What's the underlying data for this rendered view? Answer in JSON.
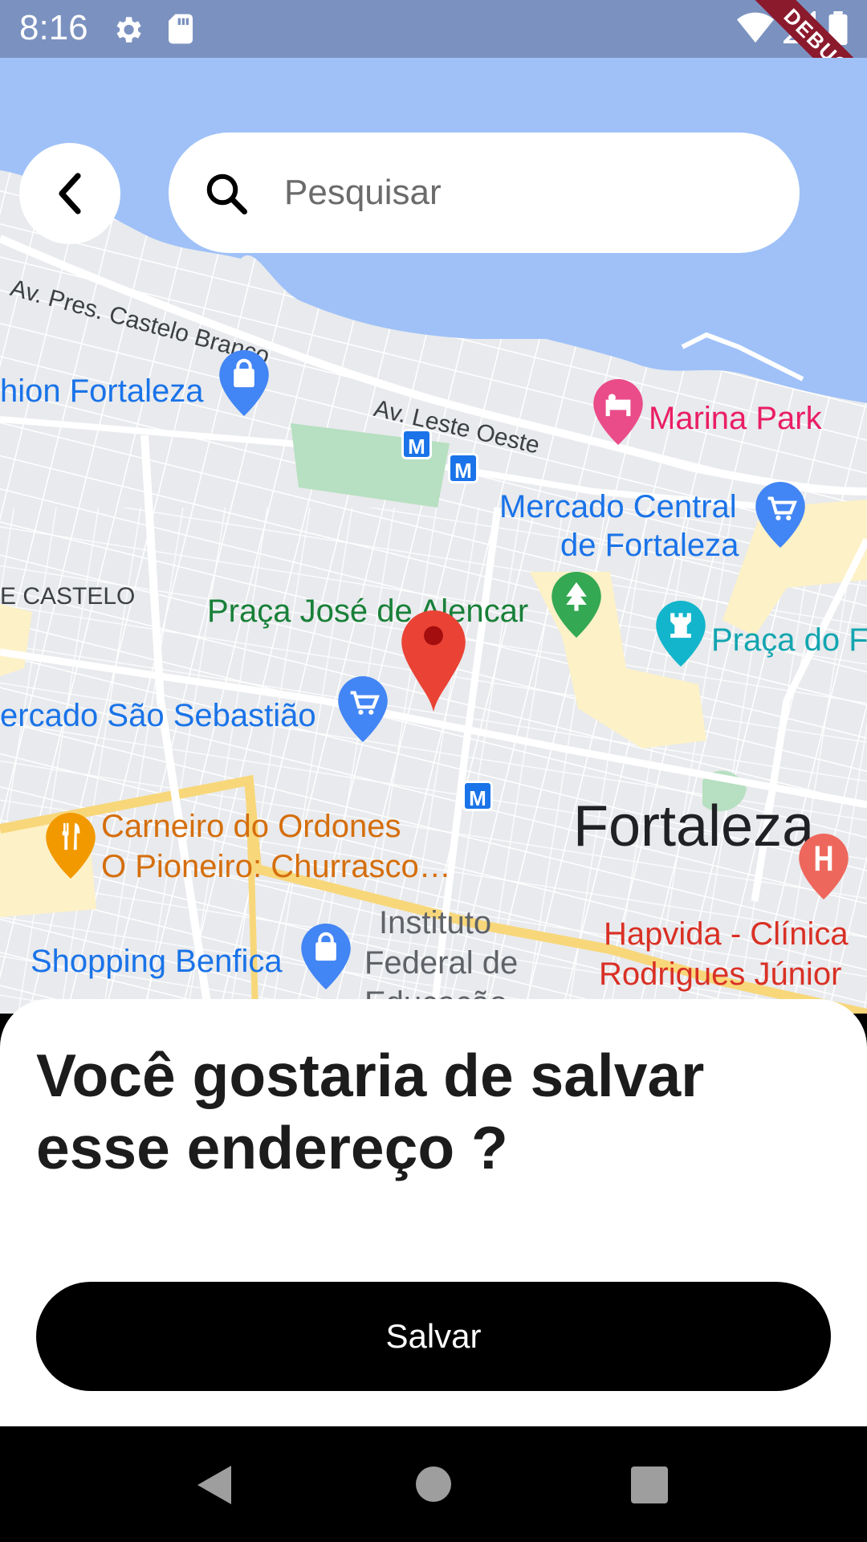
{
  "status_bar": {
    "time": "8:16",
    "debug_label": "DEBUG",
    "icons": [
      "settings-icon",
      "sd-card-icon",
      "wifi-icon",
      "signal-icon",
      "battery-icon"
    ]
  },
  "search": {
    "placeholder": "Pesquisar",
    "value": ""
  },
  "map": {
    "city_label": "Fortaleza",
    "places": [
      {
        "name": "hion Fortaleza",
        "icon": "shopping-bag-icon"
      },
      {
        "name": "Marina Park",
        "icon": "hotel-icon"
      },
      {
        "name": "Mercado Central de Fortaleza",
        "line1": "Mercado Central",
        "line2": "de Fortaleza",
        "icon": "cart-icon"
      },
      {
        "name": "Praça José de Alencar",
        "icon": "tree-icon"
      },
      {
        "name": "Praça do F",
        "icon": "chess-icon"
      },
      {
        "name": "ercado São Sebastião",
        "icon": "cart-icon"
      },
      {
        "name": "Carneiro do Ordones O Pioneiro: Churrasco…",
        "line1": "Carneiro do Ordones",
        "line2": "O Pioneiro: Churrasco…",
        "icon": "restaurant-icon"
      },
      {
        "name": "Shopping Benfica",
        "icon": "shopping-bag-icon"
      },
      {
        "name": "Instituto Federal de Educação",
        "line1": "Instituto",
        "line2": "Federal de",
        "line3": "Educação",
        "icon": ""
      },
      {
        "name": "Hapvida - Clínica Rodrigues Júnior",
        "line1": "Hapvida - Clínica",
        "line2": "Rodrigues Júnior",
        "icon": "hospital-icon"
      }
    ],
    "roads": {
      "castelo_branco": "Av. Pres. Castelo Branco",
      "leste_oeste": "Av. Leste Oeste",
      "castelo": "E CASTELO"
    },
    "metro_label": "M"
  },
  "sheet": {
    "title": "Você gostaria de salvar esse endereço ?",
    "save_label": "Salvar"
  },
  "colors": {
    "water": "#9fc1f8",
    "map_land": "#e8eaed",
    "pin": "#ea4335",
    "status_bar": "#7b92c0",
    "button": "#000000"
  }
}
